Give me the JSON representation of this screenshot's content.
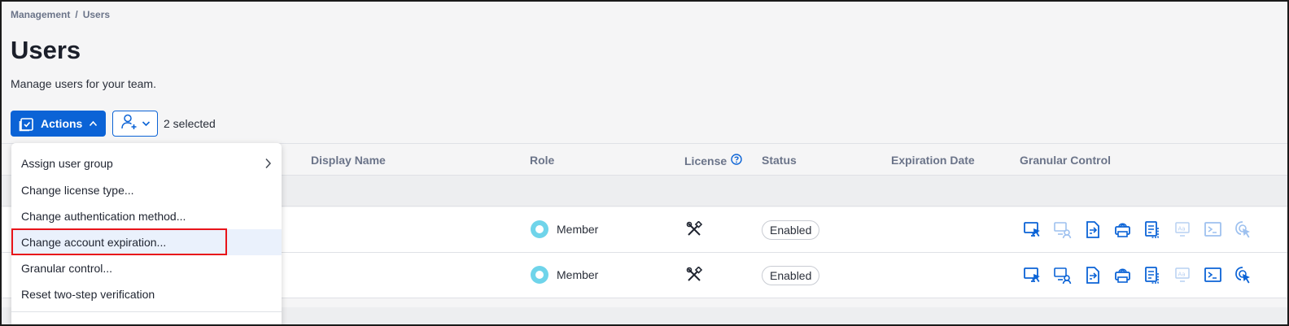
{
  "breadcrumb": {
    "parent": "Management",
    "separator": "/",
    "current": "Users"
  },
  "page": {
    "title": "Users",
    "subtitle": "Manage users for your team."
  },
  "toolbar": {
    "actions_label": "Actions",
    "selected_count": "2 selected"
  },
  "table": {
    "headers": {
      "display_name": "Display Name",
      "role": "Role",
      "license": "License",
      "status": "Status",
      "expiration": "Expiration Date",
      "granular": "Granular Control"
    },
    "rows": [
      {
        "role": "Member",
        "status": "Enabled",
        "license_icon": "tools-icon"
      },
      {
        "role": "Member",
        "status": "Enabled",
        "license_icon": "tools-icon"
      }
    ]
  },
  "menu": {
    "items": [
      {
        "label": "Assign user group",
        "has_submenu": true
      },
      {
        "label": "Change license type..."
      },
      {
        "label": "Change authentication method..."
      },
      {
        "label": "Change account expiration...",
        "highlighted": true
      },
      {
        "label": "Granular control..."
      },
      {
        "label": "Reset two-step verification"
      }
    ]
  },
  "colors": {
    "accent": "#0b63d6",
    "role_member": "#6fd4ea",
    "highlight_box": "#e8141a"
  }
}
